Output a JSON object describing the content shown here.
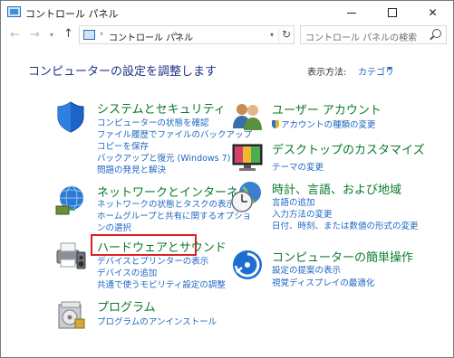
{
  "window": {
    "title": "コントロール パネル",
    "minimize_icon": "minimize-icon",
    "maximize_icon": "maximize-icon",
    "close_glyph": "✕"
  },
  "nav": {
    "back": "←",
    "forward": "→",
    "dropdown": "▾",
    "up": "↑"
  },
  "address": {
    "separator": "›",
    "path": "コントロール パネル",
    "refresh": "↻",
    "dropdown": "▾"
  },
  "search": {
    "placeholder": "コントロール パネルの検索"
  },
  "heading": "コンピューターの設定を調整します",
  "view_by": {
    "label": "表示方法:",
    "value": "カテゴリ"
  },
  "categories": [
    {
      "title": "システムとセキュリティ",
      "icon": "shield-icon",
      "links": [
        "コンピューターの状態を確認",
        "ファイル履歴でファイルのバックアップ",
        "コピーを保存",
        "バックアップと復元 (Windows 7)",
        "問題の発見と解決"
      ]
    },
    {
      "title": "ネットワークとインターネット",
      "icon": "network-globe-icon",
      "links": [
        "ネットワークの状態とタスクの表示",
        "ホームグループと共有に関するオプショ",
        "ンの選択"
      ]
    },
    {
      "title": "ハードウェアとサウンド",
      "icon": "printer-speaker-icon",
      "links": [
        "デバイスとプリンターの表示",
        "デバイスの追加",
        "共通で使うモビリティ設定の調整"
      ]
    },
    {
      "title": "プログラム",
      "icon": "programs-icon",
      "links": [
        "プログラムのアンインストール"
      ]
    },
    {
      "title": "ユーザー アカウント",
      "icon": "user-accounts-icon",
      "links": [
        "アカウントの種類の変更"
      ]
    },
    {
      "title": "デスクトップのカスタマイズ",
      "icon": "desktop-monitor-icon",
      "links": [
        "テーマの変更"
      ]
    },
    {
      "title": "時計、言語、および地域",
      "icon": "clock-globe-icon",
      "links": [
        "言語の追加",
        "入力方法の変更",
        "日付、時刻、または数値の形式の変更"
      ]
    },
    {
      "title": "コンピューターの簡単操作",
      "icon": "ease-of-access-icon",
      "links": [
        "設定の提案の表示",
        "視覚ディスプレイの最適化"
      ]
    }
  ]
}
